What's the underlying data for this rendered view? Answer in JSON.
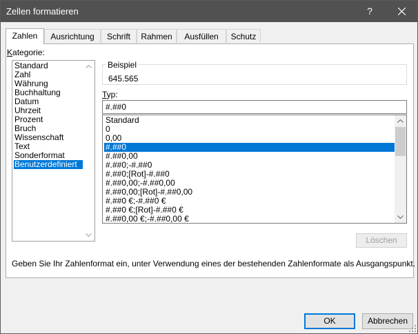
{
  "window": {
    "title": "Zellen formatieren",
    "help_glyph": "?",
    "close_icon": "close-icon"
  },
  "tabs": [
    {
      "label": "Zahlen",
      "active": true
    },
    {
      "label": "Ausrichtung",
      "active": false
    },
    {
      "label": "Schrift",
      "active": false
    },
    {
      "label": "Rahmen",
      "active": false
    },
    {
      "label": "Ausfüllen",
      "active": false
    },
    {
      "label": "Schutz",
      "active": false
    }
  ],
  "kategorie": {
    "label_prefix": "K",
    "label_rest": "ategorie:",
    "items": [
      "Standard",
      "Zahl",
      "Währung",
      "Buchhaltung",
      "Datum",
      "Uhrzeit",
      "Prozent",
      "Bruch",
      "Wissenschaft",
      "Text",
      "Sonderformat",
      "Benutzerdefiniert"
    ],
    "selected": "Benutzerdefiniert"
  },
  "beispiel": {
    "label": "Beispiel",
    "value": "645.565"
  },
  "typ": {
    "label_prefix": "T",
    "label_rest": "yp:",
    "input_value": "#.##0",
    "formats": [
      "Standard",
      "0",
      "0,00",
      "#.##0",
      "#.##0,00",
      "#.##0;-#.##0",
      "#.##0;[Rot]-#.##0",
      "#.##0,00;-#.##0,00",
      "#.##0,00;[Rot]-#.##0,00",
      "#.##0 €;-#.##0 €",
      "#.##0 €;[Rot]-#.##0 €",
      "#.##0,00 €;-#.##0,00 €"
    ],
    "selected": "#.##0"
  },
  "buttons": {
    "loeschen": "Löschen",
    "ok": "OK",
    "cancel": "Abbrechen"
  },
  "hint": "Geben Sie Ihr Zahlenformat ein, unter Verwendung eines der bestehenden Zahlenformate als Ausgangspunkt.",
  "colors": {
    "titlebar": "#515151",
    "selection": "#0078d7",
    "dialog_bg": "#f0f0f0"
  }
}
